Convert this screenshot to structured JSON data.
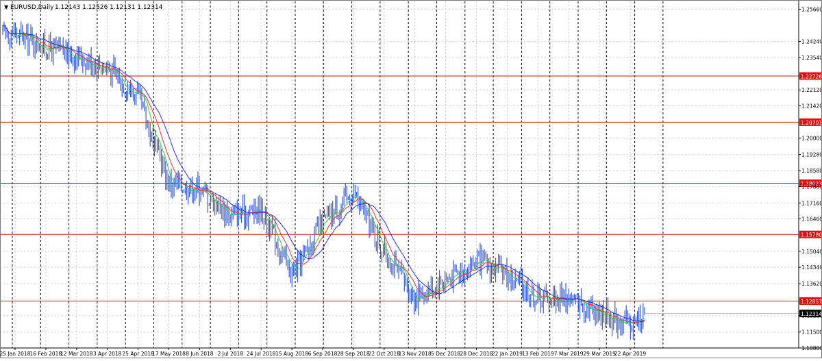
{
  "header": {
    "symbol_label": "EURUSD,Daily",
    "ohlc_label": "1.12143 1.12526 1.12131 1.12314"
  },
  "chart_data": {
    "type": "candlestick",
    "symbol": "EURUSD",
    "timeframe": "Daily",
    "ohlc": {
      "open": 1.12143,
      "high": 1.12526,
      "low": 1.12131,
      "close": 1.12314
    },
    "ylim": [
      1.108,
      1.26
    ],
    "y_ticks": [
      "1.25660",
      "1.24240",
      "1.23540",
      "1.22120",
      "1.21420",
      "1.20000",
      "1.19280",
      "1.18580",
      "1.17880",
      "1.17160",
      "1.16460",
      "1.15040",
      "1.14340",
      "1.13620",
      "1.12220",
      "1.11500",
      "1.10800"
    ],
    "x_ticks": [
      "25 Jan 2018",
      "16 Feb 2018",
      "12 Mar 2018",
      "3 Apr 2018",
      "25 Apr 2018",
      "17 May 2018",
      "8 Jun 2018",
      "2 Jul 2018",
      "24 Jul 2018",
      "15 Aug 2018",
      "6 Sep 2018",
      "28 Sep 2018",
      "22 Oct 2018",
      "13 Nov 2018",
      "5 Dec 2018",
      "28 Dec 2018",
      "22 Jan 2019",
      "13 Feb 2019",
      "7 Mar 2019",
      "29 Mar 2019",
      "22 Apr 2019"
    ],
    "levels": [
      {
        "value": 1.22726,
        "label": "1.22726"
      },
      {
        "value": 1.20701,
        "label": "1.20701"
      },
      {
        "value": 1.18023,
        "label": "1.18023"
      },
      {
        "value": 1.1578,
        "label": "1.15780"
      },
      {
        "value": 1.12857,
        "label": "1.12857"
      }
    ],
    "current_price": {
      "value": 1.12314,
      "label": "1.12314"
    },
    "price_path": [
      {
        "x": "25 Jan 2018",
        "y": 1.246
      },
      {
        "x": "16 Feb 2018",
        "y": 1.24
      },
      {
        "x": "12 Mar 2018",
        "y": 1.236
      },
      {
        "x": "3 Apr 2018",
        "y": 1.231
      },
      {
        "x": "25 Apr 2018",
        "y": 1.218
      },
      {
        "x": "17 May 2018",
        "y": 1.18
      },
      {
        "x": "8 Jun 2018",
        "y": 1.178
      },
      {
        "x": "2 Jul 2018",
        "y": 1.166
      },
      {
        "x": "24 Jul 2018",
        "y": 1.169
      },
      {
        "x": "15 Aug 2018",
        "y": 1.14
      },
      {
        "x": "6 Sep 2018",
        "y": 1.163
      },
      {
        "x": "28 Sep 2018",
        "y": 1.176
      },
      {
        "x": "22 Oct 2018",
        "y": 1.15
      },
      {
        "x": "13 Nov 2018",
        "y": 1.13
      },
      {
        "x": "5 Dec 2018",
        "y": 1.138
      },
      {
        "x": "28 Dec 2018",
        "y": 1.146
      },
      {
        "x": "22 Jan 2019",
        "y": 1.14
      },
      {
        "x": "13 Feb 2019",
        "y": 1.13
      },
      {
        "x": "7 Mar 2019",
        "y": 1.13
      },
      {
        "x": "29 Mar 2019",
        "y": 1.124
      },
      {
        "x": "22 Apr 2019",
        "y": 1.118
      },
      {
        "x": "22 Apr 2019",
        "y": 1.123
      }
    ],
    "colors": {
      "candles": "#3a5bd6",
      "ma_fast": "#2ecc40",
      "ma_mid": "#e63030",
      "ma_slow": "#2a2ae0",
      "levels": "#e01010",
      "current_price_bg": "#000000",
      "grid": "#c8c8c8",
      "separators": "#000000"
    }
  }
}
